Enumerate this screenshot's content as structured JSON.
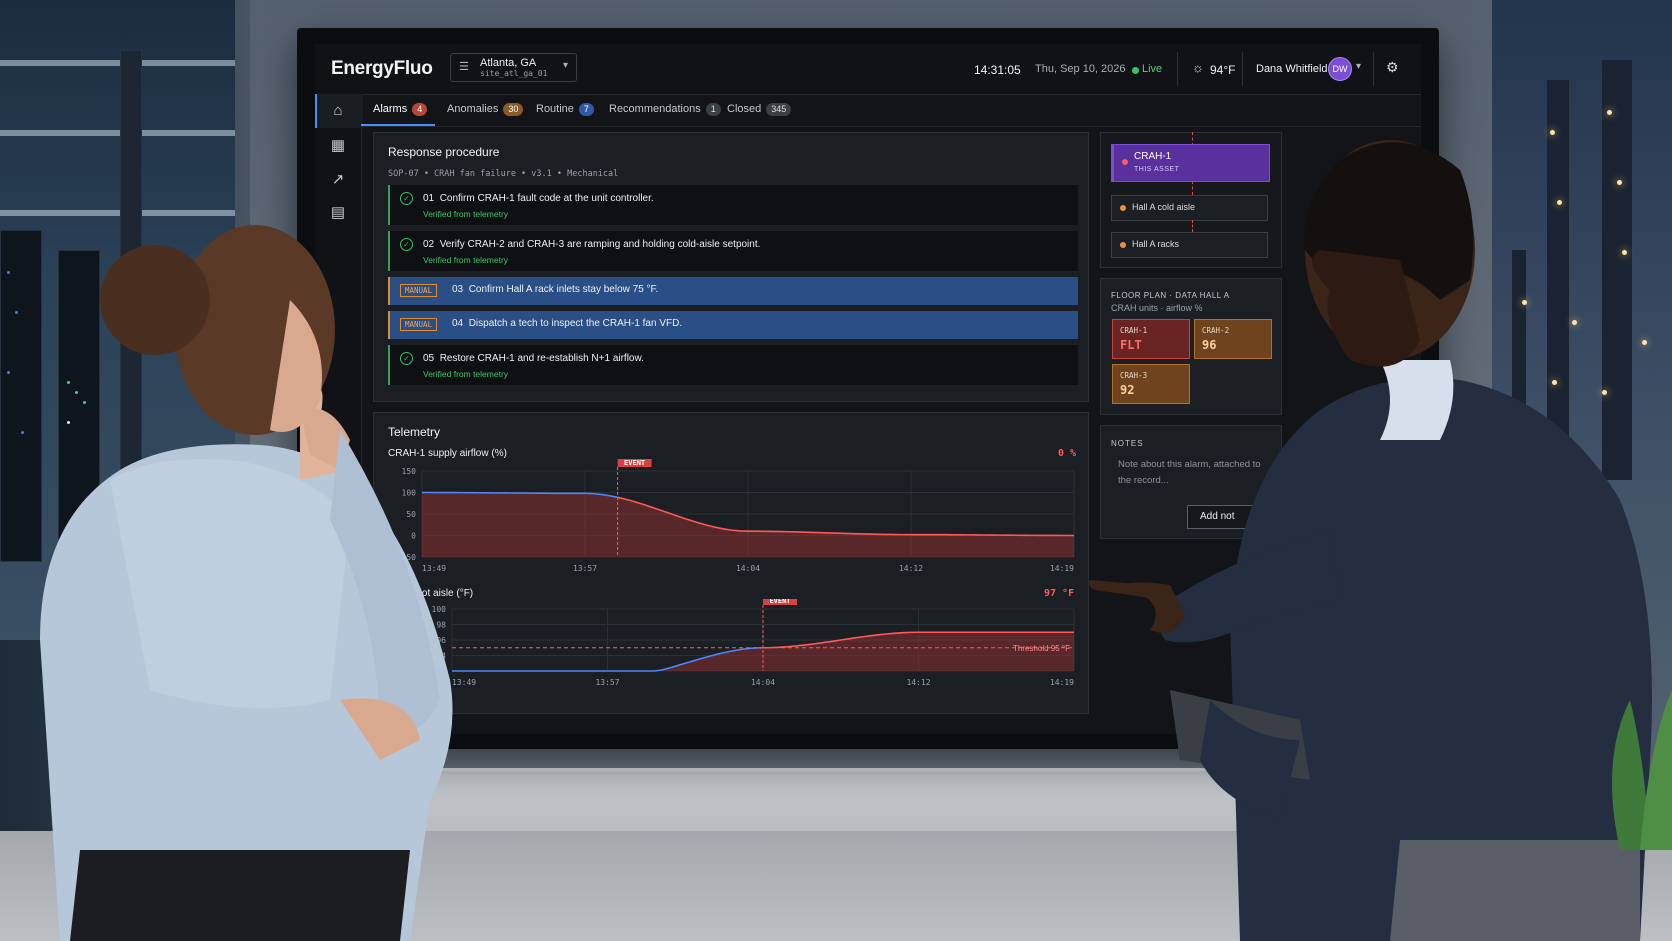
{
  "app": {
    "name": "EnergyFluo",
    "site": {
      "name": "Atlanta, GA",
      "code": "site_atl_ga_01"
    },
    "time": "14:31:05",
    "date": "Thu, Sep 10, 2026",
    "status": "Live",
    "weather": "94°F",
    "user": {
      "name": "Dana Whitfield",
      "initials": "DW"
    }
  },
  "tabs": [
    {
      "label": "Alarms",
      "count": "4",
      "color": "#b8453a"
    },
    {
      "label": "Anomalies",
      "count": "30",
      "color": "#8a5a2a"
    },
    {
      "label": "Routine",
      "count": "7",
      "color": "#2d5aa8"
    },
    {
      "label": "Recommendations",
      "count": "1",
      "color": "#3a3f46"
    },
    {
      "label": "Closed",
      "count": "345",
      "color": "#3a3f46"
    }
  ],
  "procedure": {
    "title": "Response procedure",
    "sop": "SOP-07 • CRAH fan failure • v3.1 • Mechanical",
    "verified_label": "Verified from telemetry",
    "manual_label": "MANUAL",
    "steps": [
      {
        "num": "01",
        "text": "Confirm CRAH-1 fault code at the unit controller.",
        "kind": "verified"
      },
      {
        "num": "02",
        "text": "Verify CRAH-2 and CRAH-3 are ramping and holding cold-aisle setpoint.",
        "kind": "verified"
      },
      {
        "num": "03",
        "text": "Confirm Hall A rack inlets stay below 75 °F.",
        "kind": "manual"
      },
      {
        "num": "04",
        "text": "Dispatch a tech to inspect the CRAH-1 fan VFD.",
        "kind": "manual"
      },
      {
        "num": "05",
        "text": "Restore CRAH-1 and re-establish N+1 airflow.",
        "kind": "verified"
      }
    ]
  },
  "telemetry": {
    "title": "Telemetry",
    "event_label": "EVENT",
    "charts": [
      {
        "label": "CRAH-1 supply airflow (%)",
        "current": "0 %",
        "yticks": [
          "150",
          "100",
          "50",
          "0",
          "-50"
        ],
        "xticks": [
          "13:49",
          "13:57",
          "14:04",
          "14:12",
          "14:19"
        ]
      },
      {
        "label": "Hall A hot aisle (°F)",
        "current": "97 °F",
        "yticks": [
          "100",
          "98",
          "96",
          "94",
          "92"
        ],
        "xticks": [
          "13:49",
          "13:57",
          "14:04",
          "14:12",
          "14:19"
        ],
        "threshold_label": "Threshold 95 °F"
      }
    ]
  },
  "chart_data": [
    {
      "type": "area",
      "title": "CRAH-1 supply airflow (%)",
      "x": [
        "13:49",
        "13:57",
        "14:04",
        "14:12",
        "14:19"
      ],
      "ylim": [
        -50,
        150
      ],
      "series": [
        {
          "values": [
            100,
            98,
            10,
            2,
            0
          ]
        }
      ],
      "annotations": [
        "EVENT"
      ]
    },
    {
      "type": "area",
      "title": "Hall A hot aisle (°F)",
      "x": [
        "13:49",
        "13:57",
        "14:04",
        "14:12",
        "14:19"
      ],
      "ylim": [
        92,
        100
      ],
      "series": [
        {
          "values": [
            91,
            91,
            95,
            97,
            97
          ]
        }
      ],
      "annotations": [
        "EVENT",
        "Threshold 95 °F"
      ]
    }
  ],
  "cascade": [
    {
      "label": "CRAH-1",
      "sub": "THIS ASSET"
    },
    {
      "label": "Hall A cold aisle"
    },
    {
      "label": "Hall A racks"
    }
  ],
  "floorplan": {
    "title": "FLOOR PLAN · DATA HALL A",
    "subtitle": "CRAH units · airflow %",
    "units": [
      {
        "name": "CRAH-1",
        "value": "FLT",
        "color": "#8a2b2b",
        "text": "#ff6a6a"
      },
      {
        "name": "CRAH-2",
        "value": "96",
        "color": "#7a4a1f",
        "text": "#ffcf9a"
      },
      {
        "name": "CRAH-3",
        "value": "92",
        "color": "#7a4a1f",
        "text": "#ffcf9a"
      }
    ]
  },
  "notes": {
    "title": "NOTES",
    "placeholder": "Note about this alarm, attached to the record...",
    "button": "Add not"
  }
}
